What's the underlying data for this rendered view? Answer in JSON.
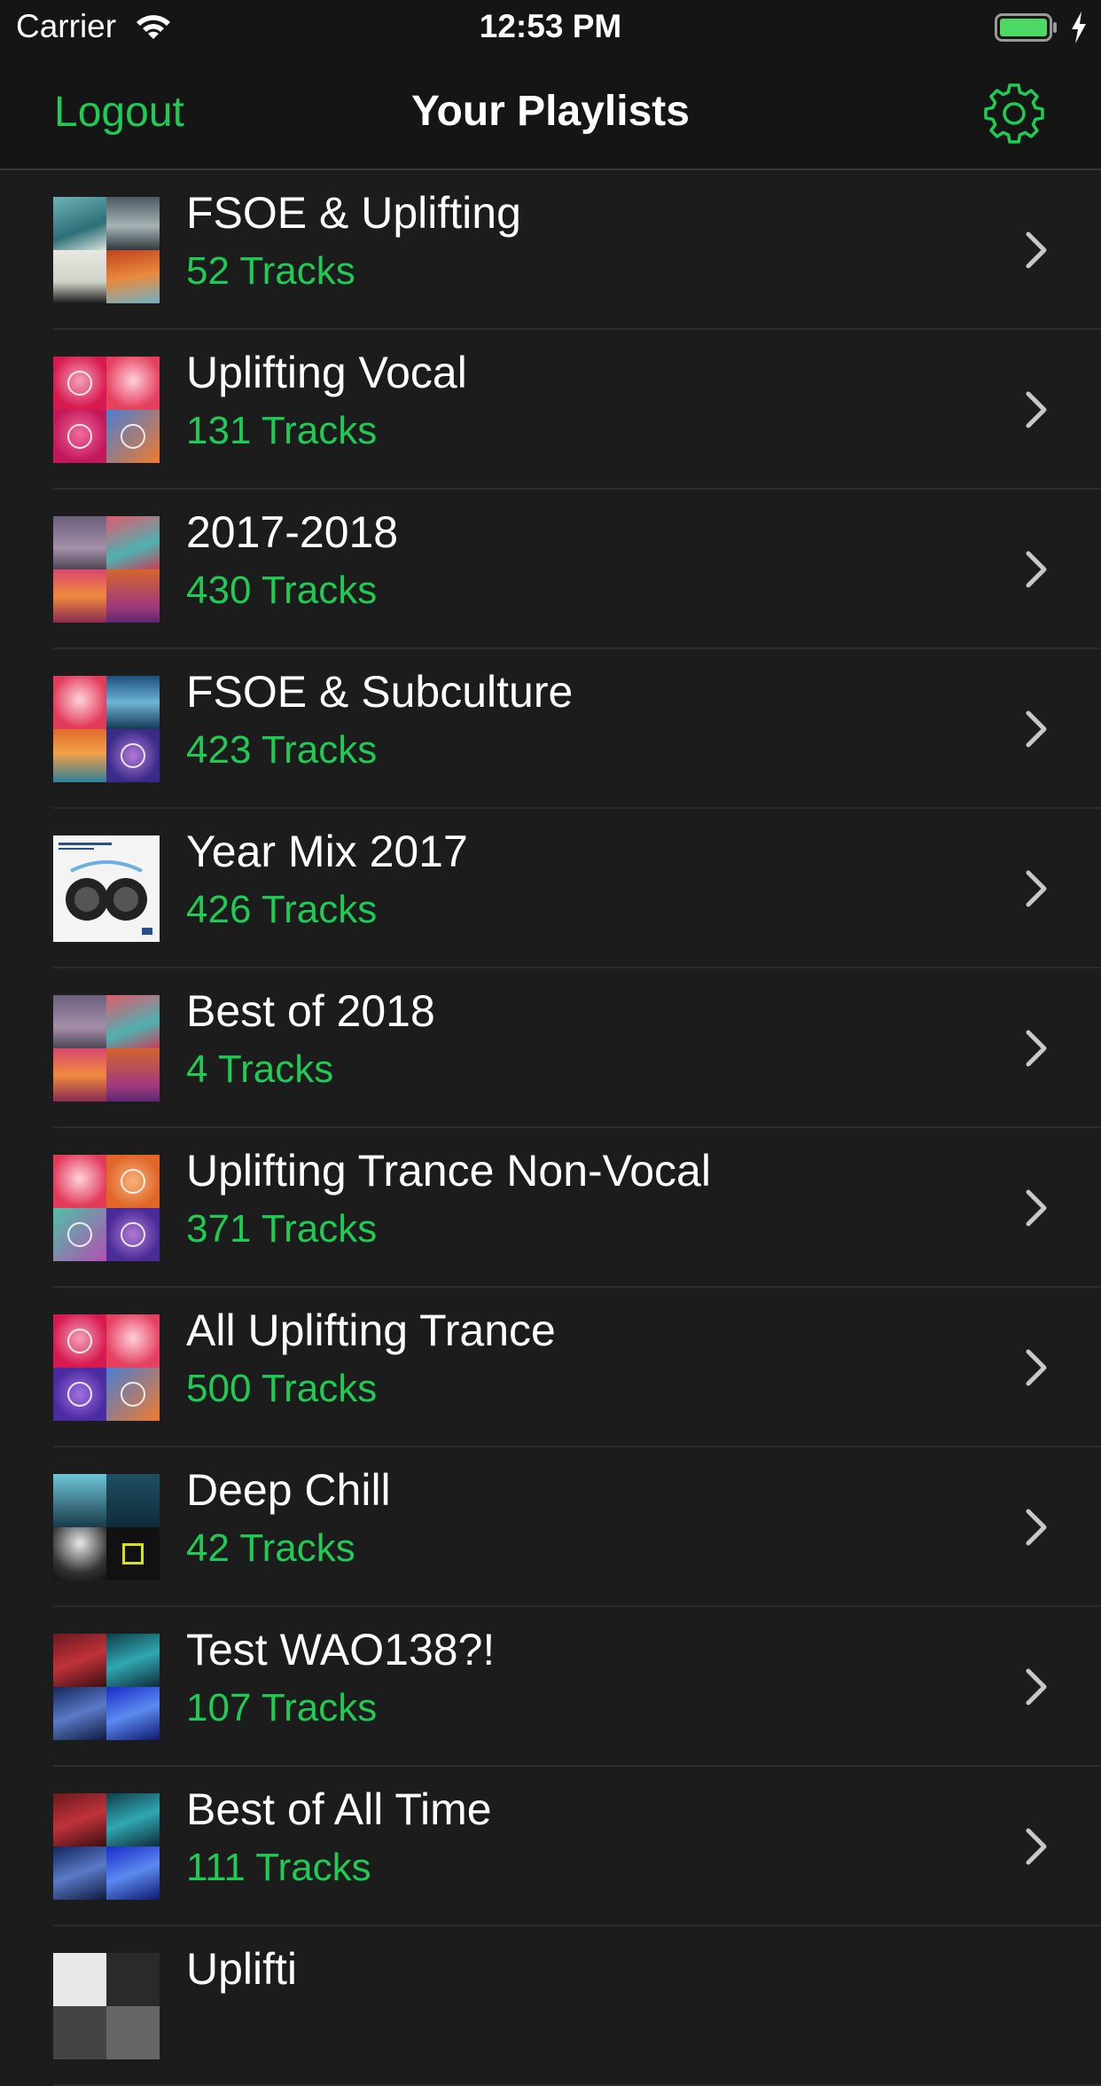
{
  "status_bar": {
    "carrier": "Carrier",
    "time": "12:53 PM",
    "battery_color": "#4cd964"
  },
  "nav": {
    "logout_label": "Logout",
    "title": "Your Playlists",
    "settings_icon": "gear-icon"
  },
  "colors": {
    "accent": "#1fcb55",
    "background": "#1c1c1c",
    "bar_background": "#151515"
  },
  "playlists": [
    {
      "name": "FSOE & Uplifting",
      "count": "52 Tracks"
    },
    {
      "name": "Uplifting Vocal",
      "count": "131 Tracks"
    },
    {
      "name": "2017-2018",
      "count": "430 Tracks"
    },
    {
      "name": "FSOE & Subculture",
      "count": "423 Tracks"
    },
    {
      "name": "Year Mix 2017",
      "count": "426 Tracks"
    },
    {
      "name": "Best of 2018",
      "count": "4 Tracks"
    },
    {
      "name": "Uplifting Trance Non-Vocal",
      "count": "371 Tracks"
    },
    {
      "name": "All Uplifting Trance",
      "count": "500 Tracks"
    },
    {
      "name": "Deep Chill",
      "count": "42 Tracks"
    },
    {
      "name": "Test WAO138?!",
      "count": "107 Tracks"
    },
    {
      "name": "Best of All Time",
      "count": "111 Tracks"
    },
    {
      "name": "Uplifti",
      "count": ""
    }
  ]
}
